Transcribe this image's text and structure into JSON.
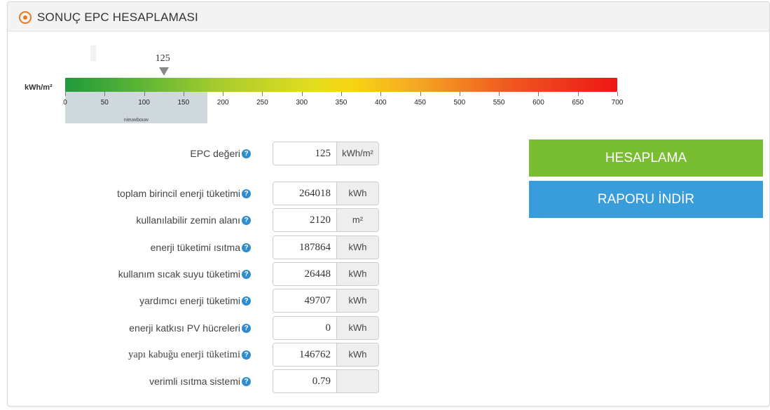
{
  "header": {
    "title": "SONUÇ EPC HESAPLAMASI"
  },
  "scale": {
    "unit_label": "kWh/m²",
    "ticks": [
      "0",
      "50",
      "100",
      "150",
      "200",
      "250",
      "300",
      "350",
      "400",
      "450",
      "500",
      "550",
      "600",
      "650",
      "700"
    ],
    "min": 0,
    "max": 700,
    "marker_value": "125",
    "marker_numeric": 125,
    "zone_label": "nieuwbouw",
    "zone_max": 180
  },
  "epc": {
    "label": "EPC değeri",
    "value": "125",
    "unit": "kWh/m²"
  },
  "rows": [
    {
      "label": "toplam birincil enerji tüketimi",
      "value": "264018",
      "unit": "kWh"
    },
    {
      "label": "kullanılabilir zemin alanı",
      "value": "2120",
      "unit": "m²"
    },
    {
      "label": "enerji tüketimi ısıtma",
      "value": "187864",
      "unit": "kWh"
    },
    {
      "label": "kullanım sıcak suyu tüketimi",
      "value": "26448",
      "unit": "kWh"
    },
    {
      "label": "yardımcı enerji tüketimi",
      "value": "49707",
      "unit": "kWh"
    },
    {
      "label": "enerji katkısı PV hücreleri",
      "value": "0",
      "unit": "kWh"
    },
    {
      "label": "yapı kabuğu enerji tüketimi",
      "value": "146762",
      "unit": "kWh"
    },
    {
      "label": "verimli ısıtma sistemi",
      "value": "0.79",
      "unit": ""
    }
  ],
  "help_glyph": "?",
  "buttons": {
    "calculate": "HESAPLAMA",
    "report": "RAPORU İNDİR"
  },
  "colors": {
    "accent_orange": "#e8791f",
    "button_green": "#79be32",
    "button_blue": "#3a9ddb",
    "help_blue": "#2e8ccf"
  }
}
